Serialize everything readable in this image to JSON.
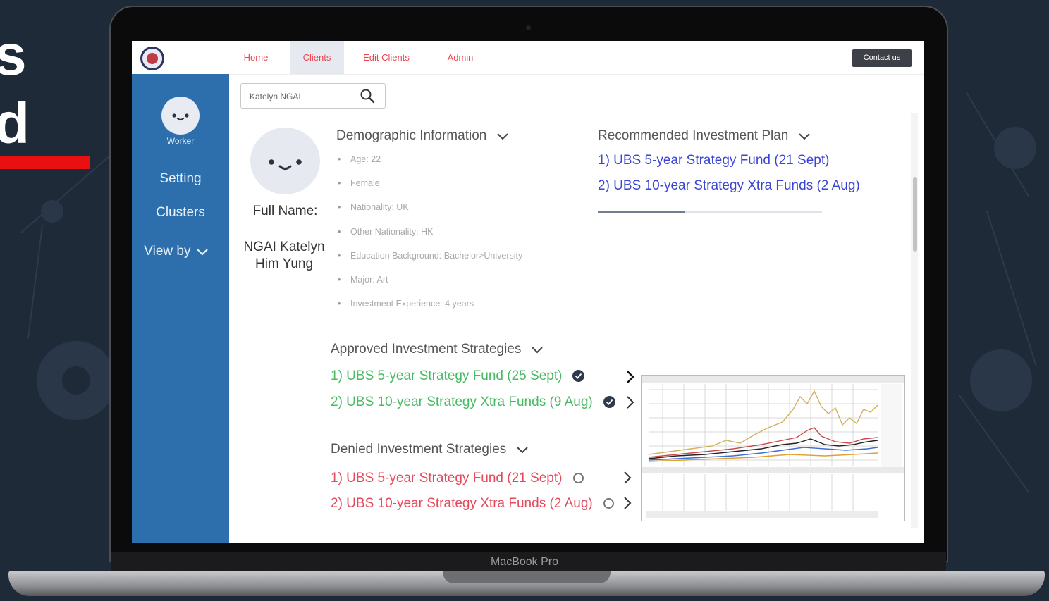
{
  "slide": {
    "line1": "s",
    "line2": "d"
  },
  "laptop": {
    "model": "MacBook Pro"
  },
  "nav": {
    "items": [
      "Home",
      "Clients",
      "Edit Clients",
      "Admin"
    ],
    "active_index": 1,
    "contact_label": "Contact us"
  },
  "sidebar": {
    "role": "Worker",
    "links": [
      "Setting",
      "Clusters",
      "View by"
    ]
  },
  "search": {
    "value": "Katelyn NGAI"
  },
  "profile": {
    "full_name_label": "Full Name:",
    "full_name": "NGAI Katelyn Him Yung"
  },
  "demographic": {
    "title": "Demographic Information",
    "items": [
      "Age: 22",
      "Female",
      "Nationality: UK",
      "Other Nationality: HK",
      "Education Background: Bachelor>University",
      "Major: Art",
      "Investment Experience: 4 years"
    ]
  },
  "recommended": {
    "title": "Recommended Investment Plan",
    "items": [
      "1) UBS 5-year Strategy Fund (21 Sept)",
      "2) UBS 10-year Strategy Xtra Funds (2 Aug)"
    ],
    "progress_fraction": 0.39
  },
  "approved": {
    "title": "Approved Investment Strategies",
    "items": [
      "1) UBS 5-year Strategy Fund (25 Sept)",
      "2) UBS 10-year Strategy Xtra Funds (9 Aug)"
    ]
  },
  "denied": {
    "title": "Denied Investment Strategies",
    "items": [
      "1) UBS 5-year Strategy Fund (21 Sept)",
      "2) UBS 10-year Strategy Xtra Funds (2 Aug)"
    ]
  },
  "colors": {
    "sidebar": "#2c6fac",
    "nav_text": "#e8474f",
    "recommended_text": "#3a45d4",
    "approved_text": "#48b964",
    "denied_text": "#e34a5c"
  },
  "icons": {
    "search": "search-icon",
    "chevron": "chevron-down-icon",
    "approved_mark": "check-circle-icon",
    "denied_mark": "empty-circle-icon",
    "row_action": "chevron-right-icon"
  }
}
